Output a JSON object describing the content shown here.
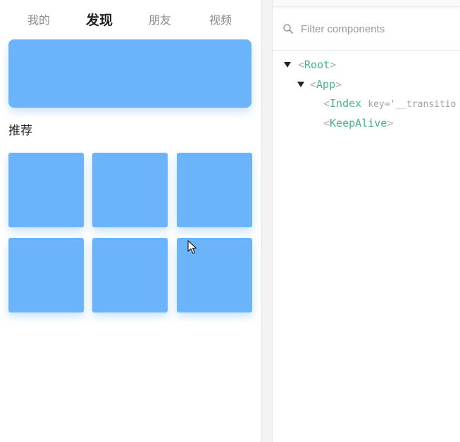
{
  "app": {
    "tabs": [
      {
        "label": "我的"
      },
      {
        "label": "发现"
      },
      {
        "label": "朋友"
      },
      {
        "label": "视频"
      }
    ],
    "active_tab": "发现",
    "section_title": "推荐",
    "tile_color": "#6bb4fb"
  },
  "devtools": {
    "filter_placeholder": "Filter components",
    "tree": {
      "root": {
        "open": "<",
        "name": "Root",
        "close": ">"
      },
      "app": {
        "open": "<",
        "name": "App",
        "close": ">"
      },
      "index": {
        "open": "<",
        "name": "Index",
        "attr": "key='__transitio"
      },
      "keepalive": {
        "open": "<",
        "name": "KeepAlive",
        "close": ">"
      }
    },
    "tag_color": "#42b983"
  }
}
